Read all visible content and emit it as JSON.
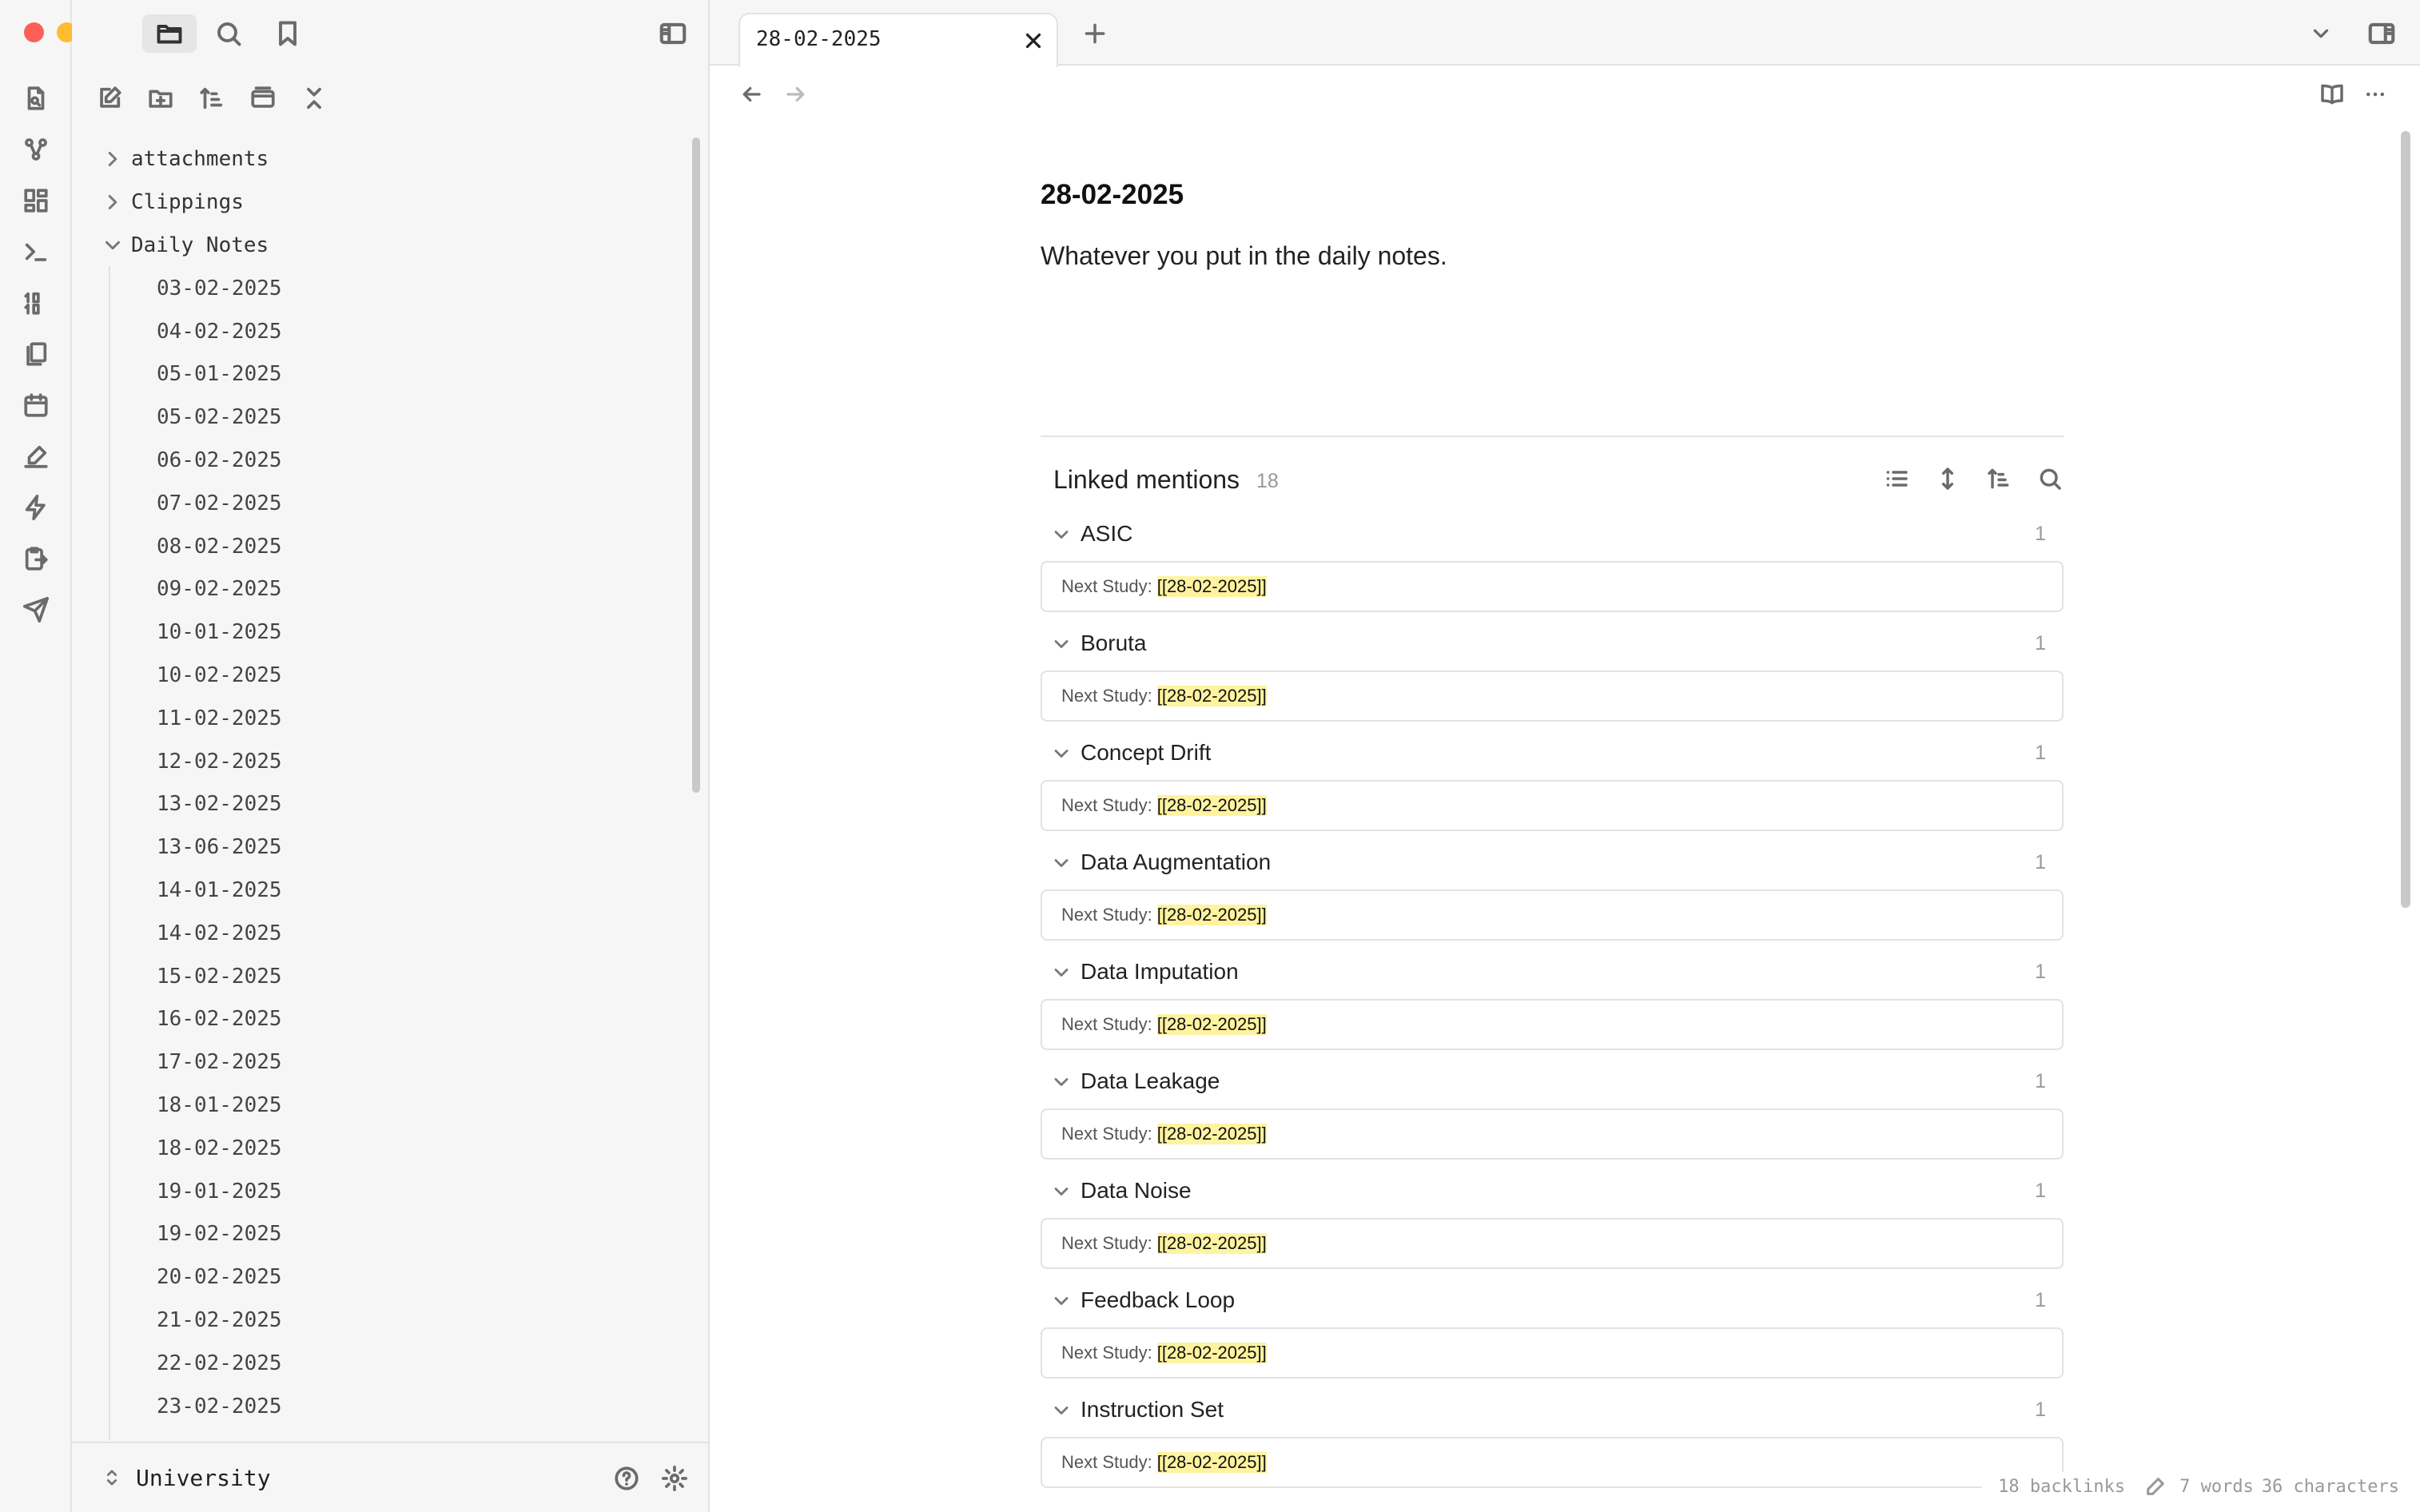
{
  "window": {
    "traffic_lights": {
      "close": "#fe5f57",
      "minimize": "#febc2e",
      "zoom": "#28c840"
    },
    "accent_highlight": "#fff3a0"
  },
  "ribbon": {
    "icons": [
      "open-quick-switcher-icon",
      "graph-view-icon",
      "canvas-icon",
      "command-palette-icon",
      "daily-notes-icon",
      "templates-icon",
      "calendar-icon",
      "draw-icon",
      "automation-icon",
      "export-icon",
      "publish-icon"
    ]
  },
  "sidebar": {
    "top_icons": [
      "folder-icon",
      "search-icon",
      "bookmark-icon",
      "sidebar-toggle-icon"
    ],
    "toolbar_icons": [
      "new-note-icon",
      "new-folder-icon",
      "sort-icon",
      "collapse-view-icon",
      "collapse-all-icon"
    ],
    "folders": [
      {
        "name": "attachments",
        "expanded": false
      },
      {
        "name": "Clippings",
        "expanded": false
      },
      {
        "name": "Daily Notes",
        "expanded": true
      }
    ],
    "files": [
      "03-02-2025",
      "04-02-2025",
      "05-01-2025",
      "05-02-2025",
      "06-02-2025",
      "07-02-2025",
      "08-02-2025",
      "09-02-2025",
      "10-01-2025",
      "10-02-2025",
      "11-02-2025",
      "12-02-2025",
      "13-02-2025",
      "13-06-2025",
      "14-01-2025",
      "14-02-2025",
      "15-02-2025",
      "16-02-2025",
      "17-02-2025",
      "18-01-2025",
      "18-02-2025",
      "19-01-2025",
      "19-02-2025",
      "20-02-2025",
      "21-02-2025",
      "22-02-2025",
      "23-02-2025"
    ],
    "vault_name": "University"
  },
  "tab": {
    "title": "28-02-2025"
  },
  "note": {
    "title": "28-02-2025",
    "body": "Whatever you put in the daily notes."
  },
  "linked_mentions": {
    "title": "Linked mentions",
    "count": "18",
    "groups": [
      {
        "title": "ASIC",
        "count": "1",
        "prefix": "Next Study:",
        "link": "[[28-02-2025]]"
      },
      {
        "title": "Boruta",
        "count": "1",
        "prefix": "Next Study:",
        "link": "[[28-02-2025]]"
      },
      {
        "title": "Concept Drift",
        "count": "1",
        "prefix": "Next Study:",
        "link": "[[28-02-2025]]"
      },
      {
        "title": "Data Augmentation",
        "count": "1",
        "prefix": "Next Study:",
        "link": "[[28-02-2025]]"
      },
      {
        "title": "Data Imputation",
        "count": "1",
        "prefix": "Next Study:",
        "link": "[[28-02-2025]]"
      },
      {
        "title": "Data Leakage",
        "count": "1",
        "prefix": "Next Study:",
        "link": "[[28-02-2025]]"
      },
      {
        "title": "Data Noise",
        "count": "1",
        "prefix": "Next Study:",
        "link": "[[28-02-2025]]"
      },
      {
        "title": "Feedback Loop",
        "count": "1",
        "prefix": "Next Study:",
        "link": "[[28-02-2025]]"
      },
      {
        "title": "Instruction Set",
        "count": "1",
        "prefix": "Next Study:",
        "link": "[[28-02-2025]]"
      }
    ]
  },
  "status_bar": {
    "backlinks": "18 backlinks",
    "words": "7 words",
    "characters": "36 characters"
  }
}
